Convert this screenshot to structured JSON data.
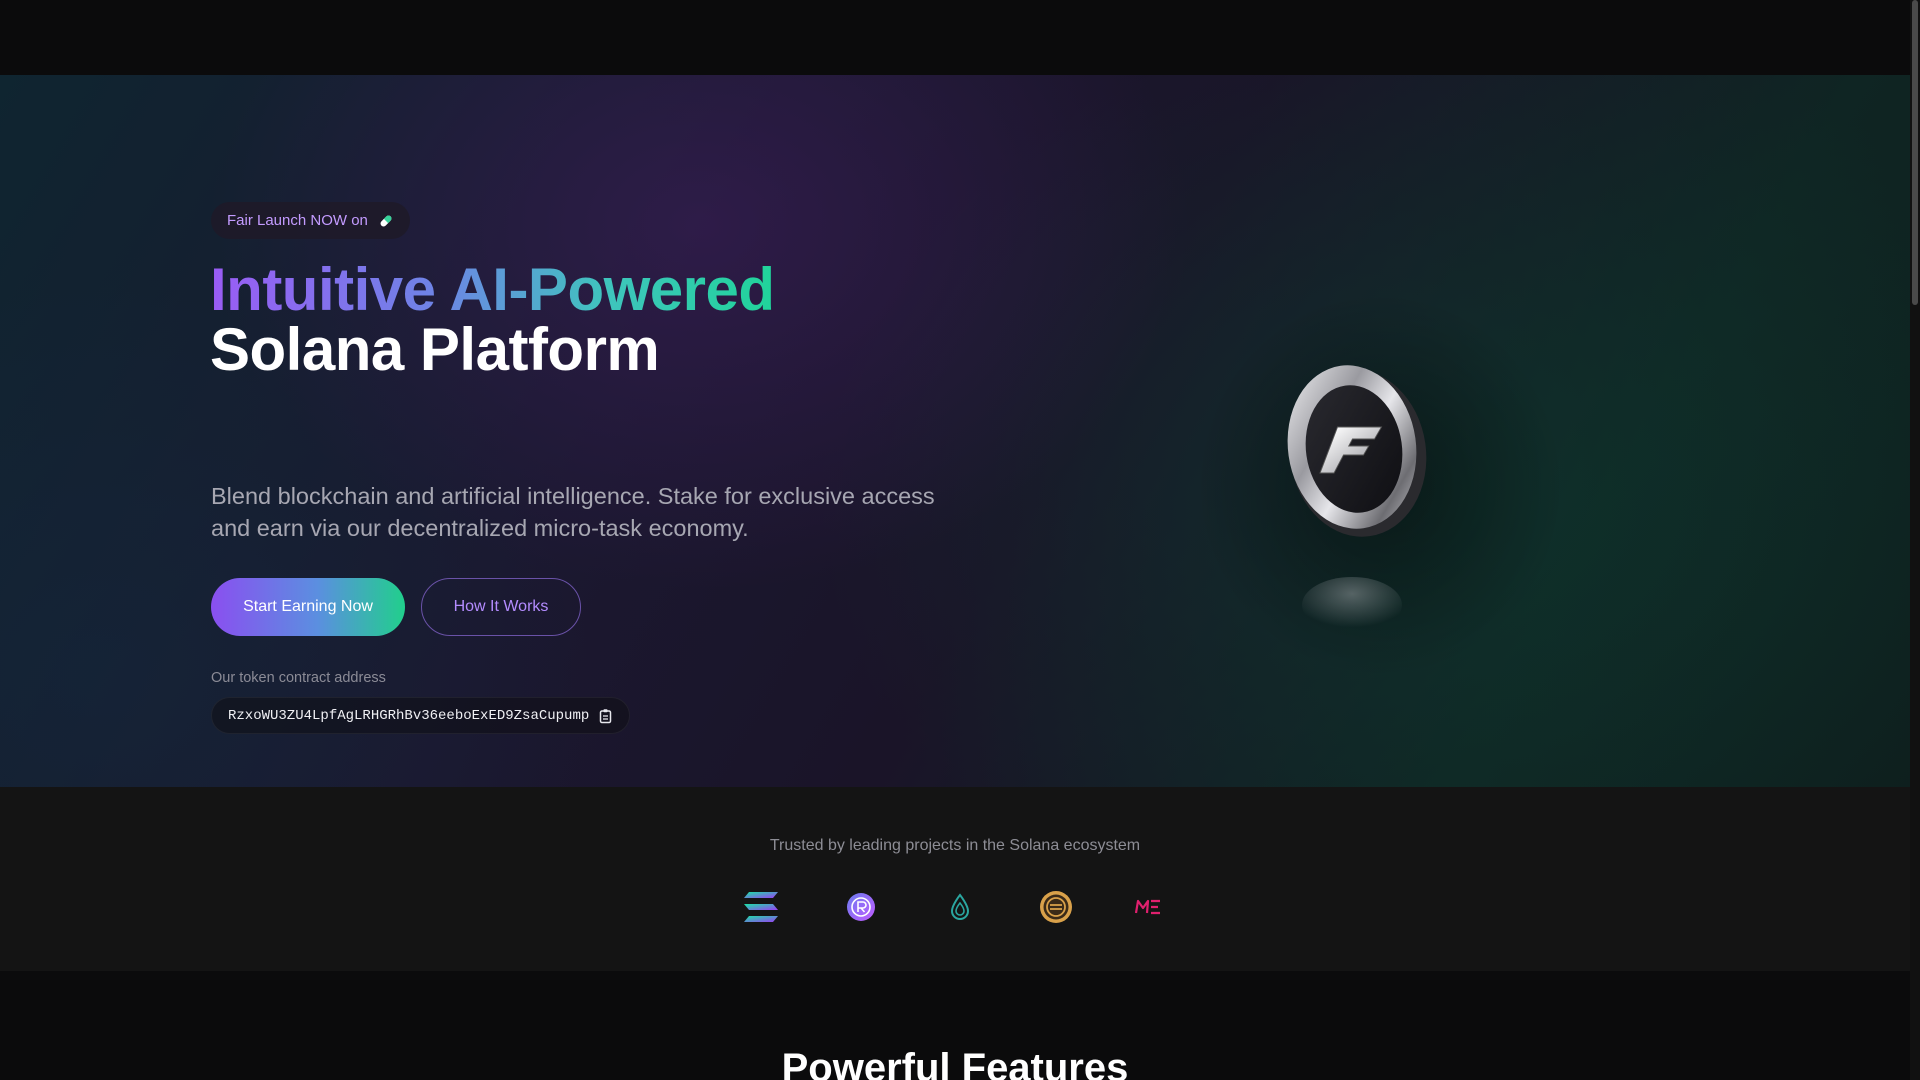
{
  "hero": {
    "badge_text": "Fair Launch NOW on",
    "badge_icon": "pill-icon",
    "headline_line1": "Intuitive AI-Powered",
    "headline_line2": "Solana Platform",
    "subtitle": "Blend blockchain and artificial intelligence. Stake for exclusive access and earn via our decentralized micro-task economy.",
    "primary_button": "Start Earning Now",
    "secondary_button": "How It Works",
    "contract_label": "Our token contract address",
    "contract_address": "RzxoWU3ZU4LpfAgLRHGRhBv36eeboExED9ZsaCupump",
    "copy_icon": "copy-icon",
    "coin_icon": "brand-coin-logo"
  },
  "trusted": {
    "text": "Trusted by leading projects in the Solana ecosystem",
    "logos": [
      "solana-logo-icon",
      "raydium-logo-icon",
      "drift-logo-icon",
      "coin-logo-icon",
      "magic-eden-logo-icon"
    ]
  },
  "features": {
    "title": "Powerful Features"
  },
  "colors": {
    "accent_purple": "#8a4ff0",
    "accent_green": "#21cf8c",
    "badge_text": "#c39bff"
  }
}
